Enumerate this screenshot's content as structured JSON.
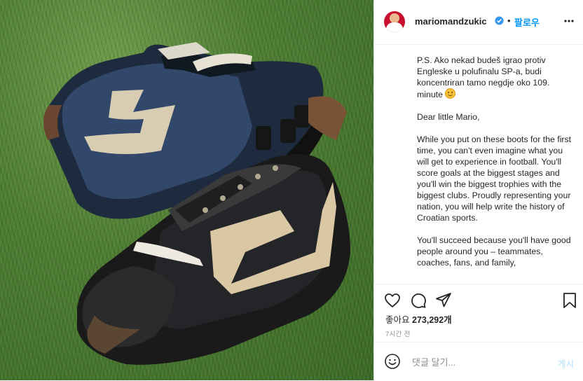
{
  "header": {
    "username": "mariomandzukic",
    "verified_icon": "verified-badge-icon",
    "separator": "•",
    "follow_label": "팔로우",
    "more_icon": "more-options-icon"
  },
  "caption": {
    "paragraphs": [
      "P.S. Ako nekad budeš igrao protiv Engleske u polufinalu SP-a, budi koncentriran tamo negdje oko 109. minute",
      "Dear little Mario,",
      "While you put on these boots for the first time, you can't even imagine what you will get to experience in football. You'll score goals at the biggest stages and you'll win the biggest trophies with the biggest clubs. Proudly representing your nation, you will help write the history of Croatian sports.",
      "You'll succeed because you'll have good people around you – teammates, coaches, fans, and family,"
    ]
  },
  "actions": {
    "like_icon": "heart-icon",
    "comment_icon": "comment-icon",
    "share_icon": "share-icon",
    "save_icon": "bookmark-icon",
    "likes_label": "좋아요",
    "likes_count": "273,292개",
    "timestamp": "7시간 전"
  },
  "comment": {
    "emoji_icon": "smiley-icon",
    "placeholder": "댓글 달기...",
    "post_label": "게시"
  },
  "colors": {
    "accent": "#0095f6",
    "post_disabled": "#b2dffc",
    "secondary_text": "#8e8e8e",
    "border": "#efefef"
  }
}
